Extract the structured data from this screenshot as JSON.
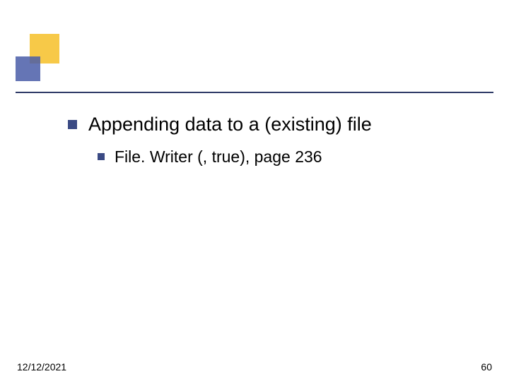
{
  "slide": {
    "bullets": {
      "level1": {
        "text": "Appending data to a (existing) file"
      },
      "level2": {
        "text": "File. Writer (, true), page 236"
      }
    }
  },
  "footer": {
    "date": "12/12/2021",
    "page": "60"
  }
}
